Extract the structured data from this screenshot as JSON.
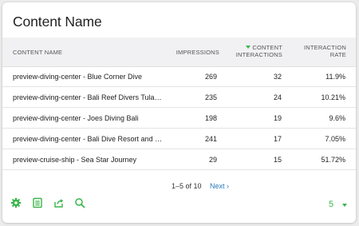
{
  "card": {
    "title": "Content Name"
  },
  "table": {
    "headers": {
      "name": "CONTENT NAME",
      "impressions": "IMPRESSIONS",
      "content_interactions_1": "CONTENT",
      "content_interactions_2": "INTERACTIONS",
      "interaction_rate_1": "INTERACTION",
      "interaction_rate_2": "RATE"
    },
    "sorted_column": "content_interactions",
    "rows": [
      {
        "name": "preview-diving-center - Blue Corner Dive",
        "impressions": "269",
        "content_interactions": "32",
        "interaction_rate": "11.9%"
      },
      {
        "name": "preview-diving-center - Bali Reef Divers Tula…",
        "impressions": "235",
        "content_interactions": "24",
        "interaction_rate": "10.21%"
      },
      {
        "name": "preview-diving-center - Joes Diving Bali",
        "impressions": "198",
        "content_interactions": "19",
        "interaction_rate": "9.6%"
      },
      {
        "name": "preview-diving-center - Bali Dive Resort and …",
        "impressions": "241",
        "content_interactions": "17",
        "interaction_rate": "7.05%"
      },
      {
        "name": "preview-cruise-ship - Sea Star Journey",
        "impressions": "29",
        "content_interactions": "15",
        "interaction_rate": "51.72%"
      }
    ]
  },
  "pager": {
    "range": "1–5 of 10",
    "next_label": "Next ›"
  },
  "toolbar": {
    "icons": [
      "gear-icon",
      "table-icon",
      "export-icon",
      "search-icon"
    ]
  },
  "page_size": {
    "value": "5"
  },
  "colors": {
    "accent": "#39b54a",
    "link": "#2a7ab9",
    "header_bg": "#f1f1f3"
  }
}
